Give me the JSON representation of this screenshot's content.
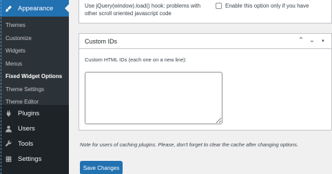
{
  "sidebar": {
    "active_menu": {
      "label": "Appearance",
      "icon": "paintbrush-icon"
    },
    "submenu": [
      {
        "label": "Themes",
        "current": false
      },
      {
        "label": "Customize",
        "current": false
      },
      {
        "label": "Widgets",
        "current": false
      },
      {
        "label": "Menus",
        "current": false
      },
      {
        "label": "Fixed Widget Options",
        "current": true
      },
      {
        "label": "Theme Settings",
        "current": false
      },
      {
        "label": "Theme Editor",
        "current": false
      }
    ],
    "menu": [
      {
        "label": "Plugins",
        "icon": "plugin-icon"
      },
      {
        "label": "Users",
        "icon": "user-icon"
      },
      {
        "label": "Tools",
        "icon": "wrench-icon"
      },
      {
        "label": "Settings",
        "icon": "settings-icon"
      }
    ],
    "colors": {
      "bg": "#1d2327",
      "submenu_bg": "#2c3338",
      "active": "#2271b1"
    }
  },
  "top_option": {
    "description": "Use jQuery(window).load() hook: problems with other scroll oriented javascript code",
    "checkbox_label": "Enable this option only if you have"
  },
  "custom_ids": {
    "title": "Custom IDs",
    "field_label": "Custom HTML IDs (each one on a new line):",
    "value": ""
  },
  "note": "Note for users of caching plugins. Please, don't forget to clear the cache after changing options.",
  "save_button": "Save Changes"
}
